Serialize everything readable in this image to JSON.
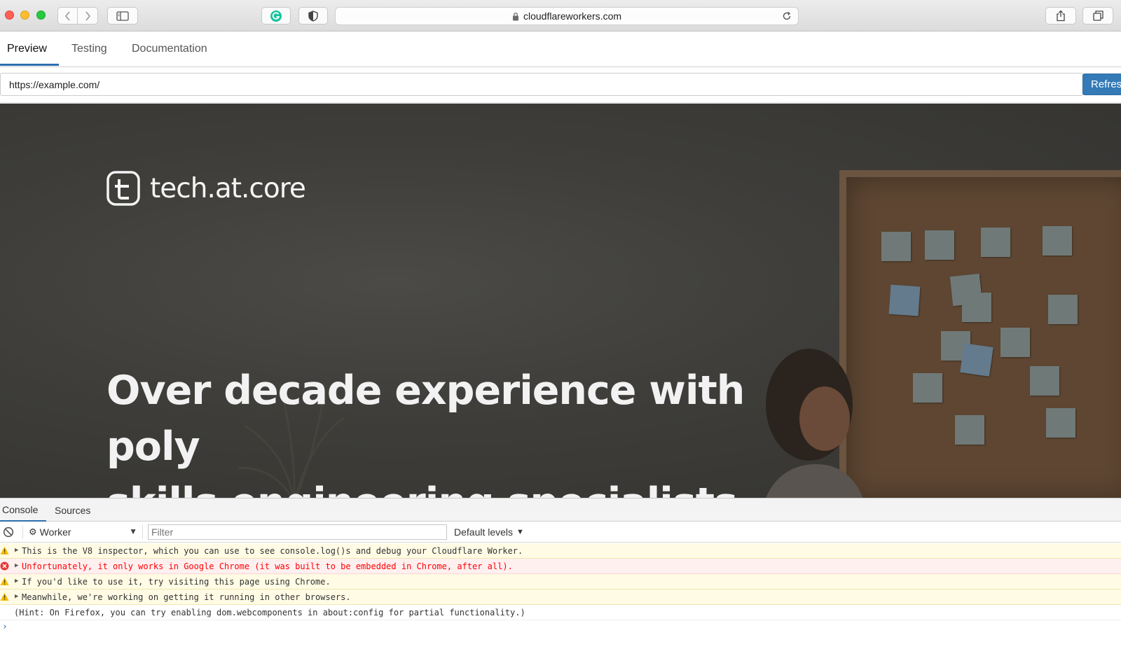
{
  "browser": {
    "url_display": "cloudflareworkers.com"
  },
  "tabs": [
    {
      "label": "Preview",
      "active": true
    },
    {
      "label": "Testing",
      "active": false
    },
    {
      "label": "Documentation",
      "active": false
    }
  ],
  "url_bar": {
    "value": "https://example.com/",
    "refresh_label": "Refresh"
  },
  "preview": {
    "logo_text": "tech.at.core",
    "headline_line1": "Over decade experience with poly",
    "headline_line2": "skills engineering specialists"
  },
  "devtools": {
    "tabs": [
      {
        "label": "Console",
        "active": true
      },
      {
        "label": "Sources",
        "active": false
      }
    ],
    "context": "Worker",
    "filter_placeholder": "Filter",
    "levels_label": "Default levels",
    "messages": [
      {
        "level": "warning",
        "text": "This is the V8 inspector, which you can use to see console.log()s and debug your Cloudflare Worker."
      },
      {
        "level": "error",
        "text": "Unfortunately, it only works in Google Chrome (it was built to be embedded in Chrome, after all)."
      },
      {
        "level": "warning",
        "text": "If you'd like to use it, try visiting this page using Chrome."
      },
      {
        "level": "warning",
        "text": "Meanwhile, we're working on getting it running in other browsers."
      },
      {
        "level": "info",
        "text": "(Hint: On Firefox, you can try enabling dom.webcomponents in about:config for partial functionality.)"
      }
    ],
    "prompt_symbol": "›"
  },
  "colors": {
    "accent": "#337ab7",
    "warning_bg": "#fffbe5",
    "error_text": "#ff0000"
  }
}
